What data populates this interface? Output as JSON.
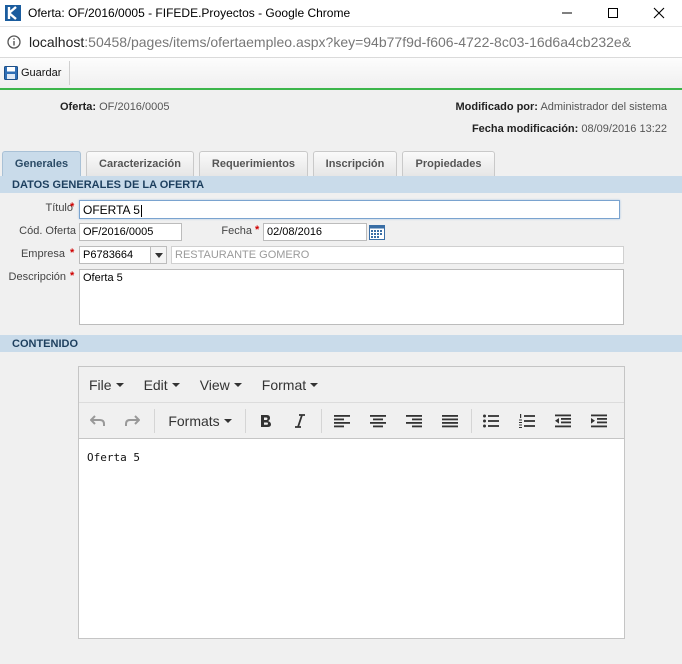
{
  "window": {
    "title": "Oferta: OF/2016/0005 - FIFEDE.Proyectos - Google Chrome",
    "url_host": "localhost",
    "url_rest": ":50458/pages/items/ofertaempleo.aspx?key=94b77f9d-f606-4722-8c03-16d6a4cb232e&"
  },
  "toolbar": {
    "save_label": "Guardar"
  },
  "header": {
    "oferta_label": "Oferta:",
    "oferta_value": "OF/2016/0005",
    "modificado_label": "Modificado por:",
    "modificado_value": "Administrador del sistema",
    "fecha_mod_label": "Fecha modificación:",
    "fecha_mod_value": "08/09/2016 13:22"
  },
  "tabs": [
    "Generales",
    "Caracterización",
    "Requerimientos",
    "Inscripción",
    "Propiedades"
  ],
  "sections": {
    "datos": "DATOS GENERALES DE LA OFERTA",
    "contenido": "CONTENIDO"
  },
  "form": {
    "titulo_label": "Título",
    "titulo_value": "OFERTA 5",
    "cod_label": "Cód. Oferta",
    "cod_value": "OF/2016/0005",
    "fecha_label": "Fecha",
    "fecha_value": "02/08/2016",
    "empresa_label": "Empresa",
    "empresa_code": "P6783664",
    "empresa_name": "RESTAURANTE GOMERO",
    "descripcion_label": "Descripción",
    "descripcion_value": "Oferta 5",
    "required_mark": "*"
  },
  "editor": {
    "menus": [
      "File",
      "Edit",
      "View",
      "Format"
    ],
    "formats_label": "Formats",
    "content": "Oferta 5"
  },
  "colors": {
    "accent_green": "#3bb54a",
    "section_bg": "#c9dbea",
    "required": "#d00000"
  }
}
